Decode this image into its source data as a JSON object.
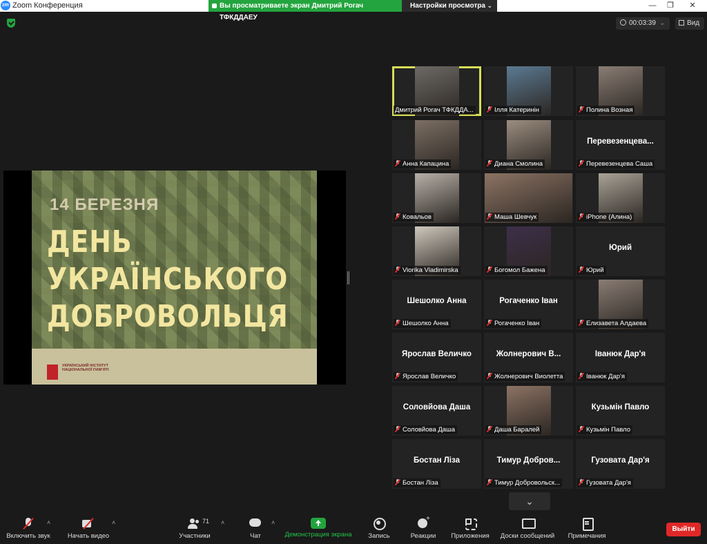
{
  "window": {
    "app_icon": "zoom-logo",
    "app_logo_text": "zm",
    "title": "Zoom Конференция",
    "controls": [
      "minimize-icon",
      "restore-icon",
      "close-icon"
    ]
  },
  "share_banner": {
    "text": "Вы просматриваете экран Дмитрий Рогач ТФКДДАЕУ",
    "view_settings": "Настройки просмотра"
  },
  "meeting": {
    "timer": "00:03:39",
    "view_label": "Вид"
  },
  "slide": {
    "date": "14 БЕРЕЗНЯ",
    "title_lines": [
      "ДЕНЬ",
      "УКРАЇНСЬКОГО",
      "ДОБРОВОЛЬЦЯ"
    ],
    "org_text": "УКРАЇНСЬКИЙ ІНСТИТУТ НАЦІОНАЛЬНОЇ ПАМ'ЯТІ"
  },
  "participants": [
    {
      "label": "Дмитрий Рогач ТФКДДА...",
      "big": "",
      "muted": false,
      "active": true,
      "video": true
    },
    {
      "label": "Ілля Катеринін",
      "big": "",
      "muted": true,
      "video": true
    },
    {
      "label": "Полина Возная",
      "big": "",
      "muted": true,
      "video": true
    },
    {
      "label": "Анна Капацина",
      "big": "",
      "muted": true,
      "video": true
    },
    {
      "label": "Диана Смолина",
      "big": "",
      "muted": true,
      "video": true
    },
    {
      "label": "Перевезенцева Саша",
      "big": "Перевезенцева...",
      "muted": true,
      "video": false
    },
    {
      "label": "Ковальов",
      "big": "",
      "muted": true,
      "video": true
    },
    {
      "label": "Маша Шевчук",
      "big": "",
      "muted": true,
      "video": true
    },
    {
      "label": "iPhone (Алина)",
      "big": "",
      "muted": true,
      "video": true
    },
    {
      "label": "Viorika Vladimirska",
      "big": "",
      "muted": true,
      "video": true
    },
    {
      "label": "Богомол Бажена",
      "big": "",
      "muted": true,
      "video": true
    },
    {
      "label": "Юрий",
      "big": "Юрий",
      "muted": true,
      "video": false
    },
    {
      "label": "Шешолко Анна",
      "big": "Шешолко Анна",
      "muted": true,
      "video": false
    },
    {
      "label": "Рогаченко Іван",
      "big": "Рогаченко Іван",
      "muted": true,
      "video": false
    },
    {
      "label": "Елизавета Алдаева",
      "big": "",
      "muted": true,
      "video": true
    },
    {
      "label": "Ярослав Величко",
      "big": "Ярослав Величко",
      "muted": true,
      "video": false
    },
    {
      "label": "Жолнерович Виолетта",
      "big": "Жолнерович В...",
      "muted": true,
      "video": false
    },
    {
      "label": "Іванюк Дар'я",
      "big": "Іванюк Дар'я",
      "muted": true,
      "video": false
    },
    {
      "label": "Соловйова Даша",
      "big": "Соловйова Даша",
      "muted": true,
      "video": false
    },
    {
      "label": "Даша Баралей",
      "big": "",
      "muted": true,
      "video": true
    },
    {
      "label": "Кузьмін Павло",
      "big": "Кузьмін Павло",
      "muted": true,
      "video": false
    },
    {
      "label": "Бостан Ліза",
      "big": "Бостан Ліза",
      "muted": true,
      "video": false
    },
    {
      "label": "Тимур Добровольск...",
      "big": "Тимур Добров...",
      "muted": true,
      "video": false
    },
    {
      "label": "Гузовата Дар'я",
      "big": "Гузовата Дар'я",
      "muted": true,
      "video": false
    }
  ],
  "toolbar": {
    "unmute": "Включить звук",
    "start_video": "Начать видео",
    "participants": "Участники",
    "participants_count": "71",
    "chat": "Чат",
    "share": "Демонстрация экрана",
    "record": "Запись",
    "reactions": "Реакции",
    "apps": "Приложения",
    "whiteboards": "Доски сообщений",
    "notes": "Примечания",
    "leave": "Выйти"
  },
  "colors": {
    "background": "#1a1a1a",
    "tile": "#232323",
    "active_border": "#d6de58",
    "share_green": "#23a43e",
    "leave_red": "#e02828"
  }
}
